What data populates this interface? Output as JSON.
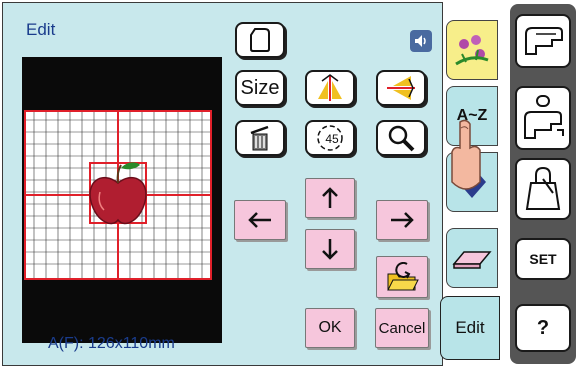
{
  "screen": {
    "title": "Edit",
    "size_label": "A(F): 126x110mm"
  },
  "buttons": {
    "size": "Size",
    "rotate_value": "45",
    "ok": "OK",
    "cancel": "Cancel"
  },
  "tabs": {
    "az": "A~Z",
    "edit": "Edit"
  },
  "side": {
    "set": "SET",
    "help": "?"
  },
  "colors": {
    "panel": "#c8e8ec",
    "accent_pink": "#f6c6dc",
    "grid_red": "#e0202a",
    "title_blue": "#1a3c8c"
  },
  "icons": [
    "pattern-icon",
    "speaker-icon",
    "mirror-horizontal-icon",
    "mirror-vertical-icon",
    "delete-icon",
    "rotate-icon",
    "magnify-icon",
    "arrow-up-icon",
    "arrow-down-icon",
    "arrow-left-icon",
    "arrow-right-icon",
    "folder-icon",
    "eraser-icon",
    "sewing-machine-icon",
    "embroidery-machine-icon",
    "bag-icon"
  ]
}
